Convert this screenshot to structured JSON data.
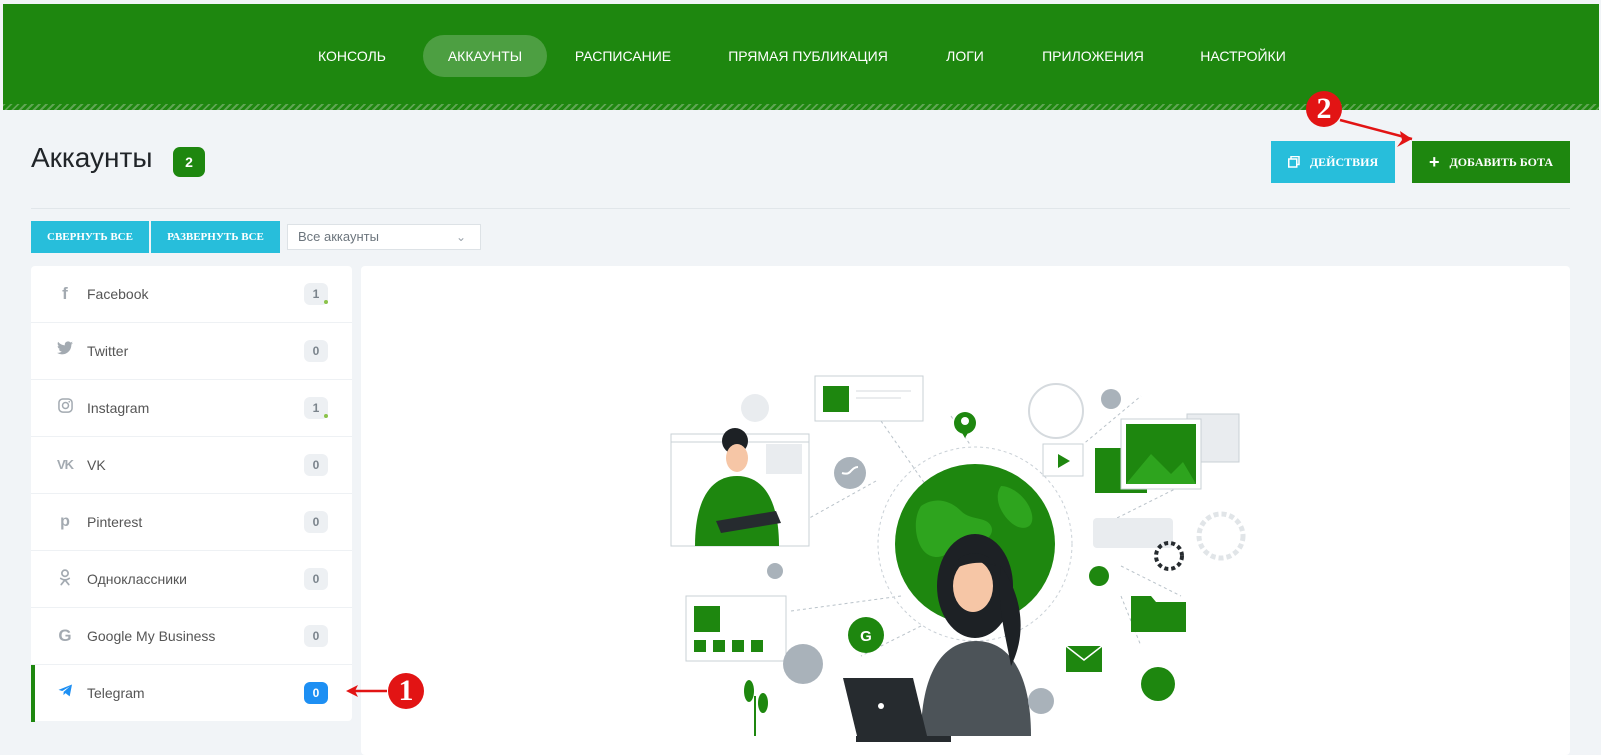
{
  "nav": {
    "items": [
      {
        "label": "Консоль"
      },
      {
        "label": "Аккаунты"
      },
      {
        "label": "Расписание"
      },
      {
        "label": "Прямая публикация"
      },
      {
        "label": "Логи"
      },
      {
        "label": "Приложения"
      },
      {
        "label": "Настройки"
      }
    ],
    "active_index": 1
  },
  "page": {
    "title": "Аккаунты",
    "count": "2"
  },
  "toolbar": {
    "actions_label": "Действия",
    "add_bot_label": "Добавить бота",
    "collapse_all_label": "Свернуть все",
    "expand_all_label": "Развернуть все",
    "filter_value": "Все аккаунты"
  },
  "sidebar": {
    "items": [
      {
        "label": "Facebook",
        "count": "1",
        "icon": "facebook-icon"
      },
      {
        "label": "Twitter",
        "count": "0",
        "icon": "twitter-icon"
      },
      {
        "label": "Instagram",
        "count": "1",
        "icon": "instagram-icon"
      },
      {
        "label": "VK",
        "count": "0",
        "icon": "vk-icon"
      },
      {
        "label": "Pinterest",
        "count": "0",
        "icon": "pinterest-icon"
      },
      {
        "label": "Одноклассники",
        "count": "0",
        "icon": "odnoklassniki-icon"
      },
      {
        "label": "Google My Business",
        "count": "0",
        "icon": "google-icon"
      },
      {
        "label": "Telegram",
        "count": "0",
        "icon": "telegram-icon"
      }
    ],
    "active_index": 7
  },
  "annotations": {
    "callout_1": "1",
    "callout_2": "2"
  },
  "colors": {
    "brand_green": "#1e870f",
    "cyan": "#27bedb",
    "telegram_blue": "#1d8ff3",
    "callout_red": "#e21414"
  }
}
